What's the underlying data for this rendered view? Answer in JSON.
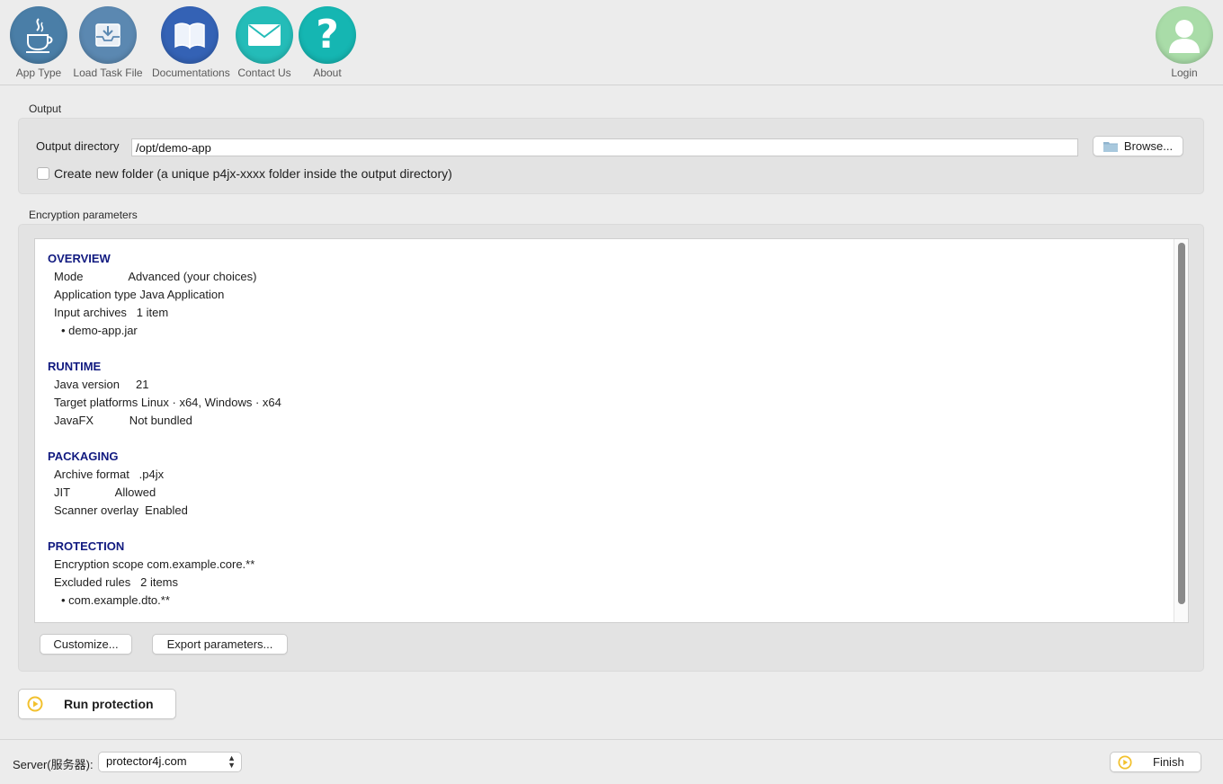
{
  "toolbar": {
    "items": [
      {
        "label": "App Type",
        "icon": "java-cup-icon",
        "color": "#3f7aa8"
      },
      {
        "label": "Load Task File",
        "icon": "inbox-download-icon",
        "color": "#4f86b6"
      },
      {
        "label": "Documentations",
        "icon": "open-book-icon",
        "color": "#2d5fb5"
      },
      {
        "label": "Contact Us",
        "icon": "envelope-icon",
        "color": "#1fb9b6"
      },
      {
        "label": "About",
        "icon": "question-mark-icon",
        "color": "#12b4b0"
      }
    ],
    "login": {
      "label": "Login",
      "icon": "user-avatar-icon",
      "color": "#a6dca5"
    }
  },
  "output": {
    "section_title": "Output",
    "directory_label": "Output directory",
    "directory_value": "/opt/demo-app",
    "browse_label": "Browse...",
    "create_folder_label": "Create new folder (a unique p4jx-xxxx folder inside the output directory)",
    "create_folder_checked": false
  },
  "encryption": {
    "section_title": "Encryption parameters",
    "overview": {
      "heading": "OVERVIEW",
      "lines": [
        "Mode              Advanced (your choices)",
        "Application type Java Application",
        "Input archives   1 item"
      ],
      "bullets": [
        "• demo-app.jar"
      ]
    },
    "runtime": {
      "heading": "RUNTIME",
      "lines": [
        "Java version     21",
        "Target platforms Linux · x64, Windows · x64",
        "JavaFX           Not bundled"
      ]
    },
    "packaging": {
      "heading": "PACKAGING",
      "lines": [
        "Archive format   .p4jx",
        "JIT              Allowed",
        "Scanner overlay  Enabled"
      ]
    },
    "protection": {
      "heading": "PROTECTION",
      "lines": [
        "Encryption scope com.example.core.**",
        "Excluded rules   2 items"
      ],
      "bullets": [
        "• com.example.dto.**"
      ]
    },
    "customize_label": "Customize...",
    "export_label": "Export parameters..."
  },
  "run": {
    "label": "Run protection",
    "accent": "#f2c12e"
  },
  "bottom": {
    "server_label": "Server(服务器):",
    "server_value": "protector4j.com",
    "finish_label": "Finish"
  }
}
